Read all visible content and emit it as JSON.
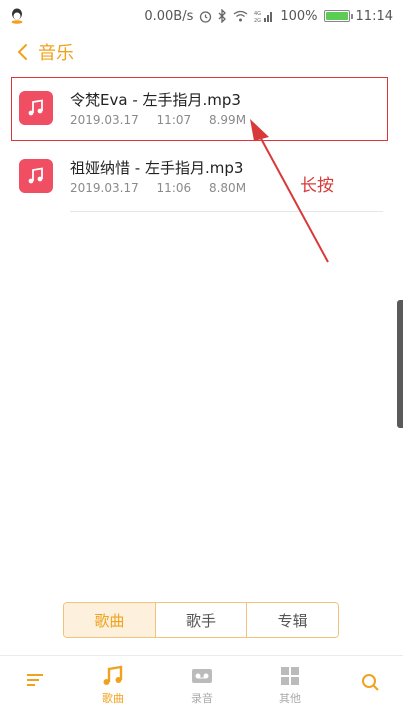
{
  "status_bar": {
    "net_speed": "0.00B/s",
    "battery": "100%",
    "time": "11:14",
    "icons": [
      "qq-icon",
      "alarm-icon",
      "bluetooth-icon",
      "wifi-icon",
      "signal-icon",
      "battery-icon"
    ]
  },
  "header": {
    "title": "音乐"
  },
  "files": [
    {
      "name": "令梵Eva - 左手指月.mp3",
      "date": "2019.03.17",
      "time": "11:07",
      "size": "8.99M"
    },
    {
      "name": "祖娅纳惜 - 左手指月.mp3",
      "date": "2019.03.17",
      "time": "11:06",
      "size": "8.80M"
    }
  ],
  "annotation": {
    "text": "长按",
    "color": "#d83a3a"
  },
  "segments": [
    {
      "label": "歌曲",
      "active": true
    },
    {
      "label": "歌手",
      "active": false
    },
    {
      "label": "专辑",
      "active": false
    }
  ],
  "bottom_nav": [
    {
      "label": "",
      "icon": "menu-icon"
    },
    {
      "label": "歌曲",
      "icon": "music-note-icon",
      "active": true
    },
    {
      "label": "录音",
      "icon": "voicemail-icon"
    },
    {
      "label": "其他",
      "icon": "apps-icon"
    },
    {
      "label": "",
      "icon": "search-icon"
    }
  ],
  "colors": {
    "accent": "#f0a21e",
    "file_icon": "#ef4e63"
  }
}
